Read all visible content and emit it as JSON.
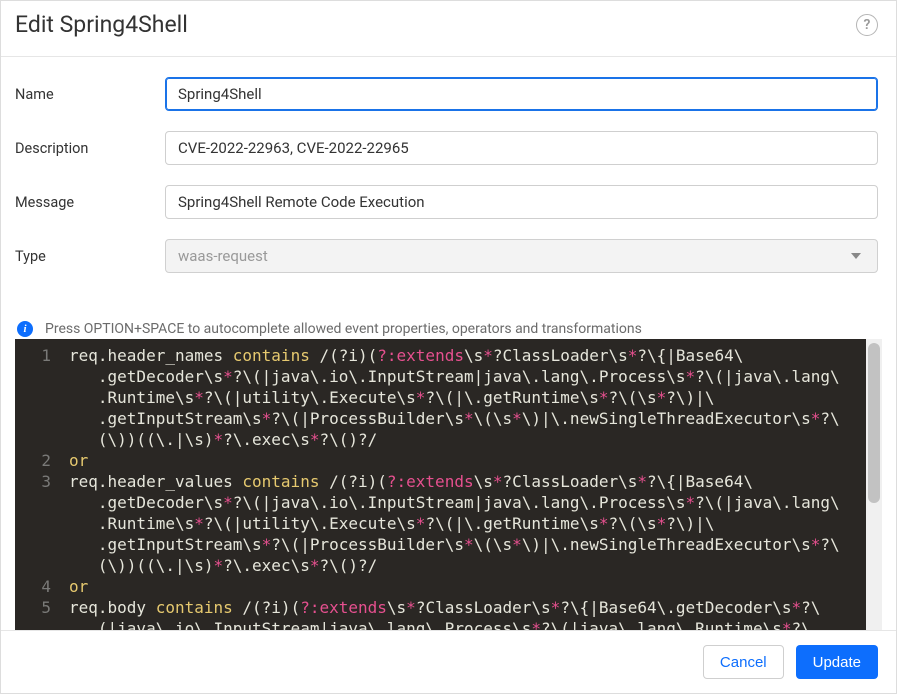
{
  "header": {
    "title": "Edit Spring4Shell",
    "help_label": "?"
  },
  "form": {
    "name_label": "Name",
    "name_value": "Spring4Shell",
    "description_label": "Description",
    "description_value": "CVE-2022-22963, CVE-2022-22965",
    "message_label": "Message",
    "message_value": "Spring4Shell Remote Code Execution",
    "type_label": "Type",
    "type_value": "waas-request"
  },
  "hint": {
    "icon": "i",
    "text": "Press OPTION+SPACE to autocomplete allowed event properties, operators and transformations"
  },
  "editor": {
    "lines": [
      {
        "n": "1",
        "segments": [
          {
            "t": "req.header_names ",
            "c": "tok-default"
          },
          {
            "t": "contains",
            "c": "tok-gold"
          },
          {
            "t": " /(?i)(",
            "c": "tok-default"
          },
          {
            "t": "?:extends",
            "c": "tok-pink"
          },
          {
            "t": "\\s",
            "c": "tok-default"
          },
          {
            "t": "*",
            "c": "tok-pink"
          },
          {
            "t": "?ClassLoader\\s",
            "c": "tok-default"
          },
          {
            "t": "*",
            "c": "tok-pink"
          },
          {
            "t": "?\\{|Base64\\",
            "c": "tok-default"
          }
        ]
      },
      {
        "n": "",
        "segments": [
          {
            "t": "   .getDecoder\\s",
            "c": "tok-default"
          },
          {
            "t": "*",
            "c": "tok-pink"
          },
          {
            "t": "?\\(|java\\.io\\.InputStream|java\\.lang\\.Process\\s",
            "c": "tok-default"
          },
          {
            "t": "*",
            "c": "tok-pink"
          },
          {
            "t": "?\\(|java\\.lang\\",
            "c": "tok-default"
          }
        ]
      },
      {
        "n": "",
        "segments": [
          {
            "t": "   .Runtime\\s",
            "c": "tok-default"
          },
          {
            "t": "*",
            "c": "tok-pink"
          },
          {
            "t": "?\\(|utility\\.Execute\\s",
            "c": "tok-default"
          },
          {
            "t": "*",
            "c": "tok-pink"
          },
          {
            "t": "?\\(|\\.getRuntime\\s",
            "c": "tok-default"
          },
          {
            "t": "*",
            "c": "tok-pink"
          },
          {
            "t": "?\\(\\s",
            "c": "tok-default"
          },
          {
            "t": "*",
            "c": "tok-pink"
          },
          {
            "t": "?\\)|\\",
            "c": "tok-default"
          }
        ]
      },
      {
        "n": "",
        "segments": [
          {
            "t": "   .getInputStream\\s",
            "c": "tok-default"
          },
          {
            "t": "*",
            "c": "tok-pink"
          },
          {
            "t": "?\\(|ProcessBuilder\\s",
            "c": "tok-default"
          },
          {
            "t": "*",
            "c": "tok-pink"
          },
          {
            "t": "\\(\\s",
            "c": "tok-default"
          },
          {
            "t": "*",
            "c": "tok-pink"
          },
          {
            "t": "\\)|\\.newSingleThreadExecutor\\s",
            "c": "tok-default"
          },
          {
            "t": "*",
            "c": "tok-pink"
          },
          {
            "t": "?\\",
            "c": "tok-default"
          }
        ]
      },
      {
        "n": "",
        "segments": [
          {
            "t": "   (\\))((\\.|\\s)",
            "c": "tok-default"
          },
          {
            "t": "*",
            "c": "tok-pink"
          },
          {
            "t": "?\\.exec\\s",
            "c": "tok-default"
          },
          {
            "t": "*",
            "c": "tok-pink"
          },
          {
            "t": "?\\()?/",
            "c": "tok-default"
          }
        ]
      },
      {
        "n": "2",
        "segments": [
          {
            "t": "or",
            "c": "tok-gold"
          }
        ]
      },
      {
        "n": "3",
        "segments": [
          {
            "t": "req.header_values ",
            "c": "tok-default"
          },
          {
            "t": "contains",
            "c": "tok-gold"
          },
          {
            "t": " /(?i)(",
            "c": "tok-default"
          },
          {
            "t": "?:extends",
            "c": "tok-pink"
          },
          {
            "t": "\\s",
            "c": "tok-default"
          },
          {
            "t": "*",
            "c": "tok-pink"
          },
          {
            "t": "?ClassLoader\\s",
            "c": "tok-default"
          },
          {
            "t": "*",
            "c": "tok-pink"
          },
          {
            "t": "?\\{|Base64\\",
            "c": "tok-default"
          }
        ]
      },
      {
        "n": "",
        "segments": [
          {
            "t": "   .getDecoder\\s",
            "c": "tok-default"
          },
          {
            "t": "*",
            "c": "tok-pink"
          },
          {
            "t": "?\\(|java\\.io\\.InputStream|java\\.lang\\.Process\\s",
            "c": "tok-default"
          },
          {
            "t": "*",
            "c": "tok-pink"
          },
          {
            "t": "?\\(|java\\.lang\\",
            "c": "tok-default"
          }
        ]
      },
      {
        "n": "",
        "segments": [
          {
            "t": "   .Runtime\\s",
            "c": "tok-default"
          },
          {
            "t": "*",
            "c": "tok-pink"
          },
          {
            "t": "?\\(|utility\\.Execute\\s",
            "c": "tok-default"
          },
          {
            "t": "*",
            "c": "tok-pink"
          },
          {
            "t": "?\\(|\\.getRuntime\\s",
            "c": "tok-default"
          },
          {
            "t": "*",
            "c": "tok-pink"
          },
          {
            "t": "?\\(\\s",
            "c": "tok-default"
          },
          {
            "t": "*",
            "c": "tok-pink"
          },
          {
            "t": "?\\)|\\",
            "c": "tok-default"
          }
        ]
      },
      {
        "n": "",
        "segments": [
          {
            "t": "   .getInputStream\\s",
            "c": "tok-default"
          },
          {
            "t": "*",
            "c": "tok-pink"
          },
          {
            "t": "?\\(|ProcessBuilder\\s",
            "c": "tok-default"
          },
          {
            "t": "*",
            "c": "tok-pink"
          },
          {
            "t": "\\(\\s",
            "c": "tok-default"
          },
          {
            "t": "*",
            "c": "tok-pink"
          },
          {
            "t": "\\)|\\.newSingleThreadExecutor\\s",
            "c": "tok-default"
          },
          {
            "t": "*",
            "c": "tok-pink"
          },
          {
            "t": "?\\",
            "c": "tok-default"
          }
        ]
      },
      {
        "n": "",
        "segments": [
          {
            "t": "   (\\))((\\.|\\s)",
            "c": "tok-default"
          },
          {
            "t": "*",
            "c": "tok-pink"
          },
          {
            "t": "?\\.exec\\s",
            "c": "tok-default"
          },
          {
            "t": "*",
            "c": "tok-pink"
          },
          {
            "t": "?\\()?/",
            "c": "tok-default"
          }
        ]
      },
      {
        "n": "4",
        "segments": [
          {
            "t": "or",
            "c": "tok-gold"
          }
        ]
      },
      {
        "n": "5",
        "segments": [
          {
            "t": "req.body ",
            "c": "tok-default"
          },
          {
            "t": "contains",
            "c": "tok-gold"
          },
          {
            "t": " /(?i)(",
            "c": "tok-default"
          },
          {
            "t": "?:extends",
            "c": "tok-pink"
          },
          {
            "t": "\\s",
            "c": "tok-default"
          },
          {
            "t": "*",
            "c": "tok-pink"
          },
          {
            "t": "?ClassLoader\\s",
            "c": "tok-default"
          },
          {
            "t": "*",
            "c": "tok-pink"
          },
          {
            "t": "?\\{|Base64\\.getDecoder\\s",
            "c": "tok-default"
          },
          {
            "t": "*",
            "c": "tok-pink"
          },
          {
            "t": "?\\",
            "c": "tok-default"
          }
        ]
      },
      {
        "n": "",
        "segments": [
          {
            "t": "   (|java\\.io\\.InputStream|java\\.lang\\.Process\\s",
            "c": "tok-default"
          },
          {
            "t": "*",
            "c": "tok-pink"
          },
          {
            "t": "?\\(|java\\.lang\\.Runtime\\s",
            "c": "tok-default"
          },
          {
            "t": "*",
            "c": "tok-pink"
          },
          {
            "t": "?\\",
            "c": "tok-default"
          }
        ]
      }
    ]
  },
  "footer": {
    "cancel": "Cancel",
    "update": "Update"
  }
}
